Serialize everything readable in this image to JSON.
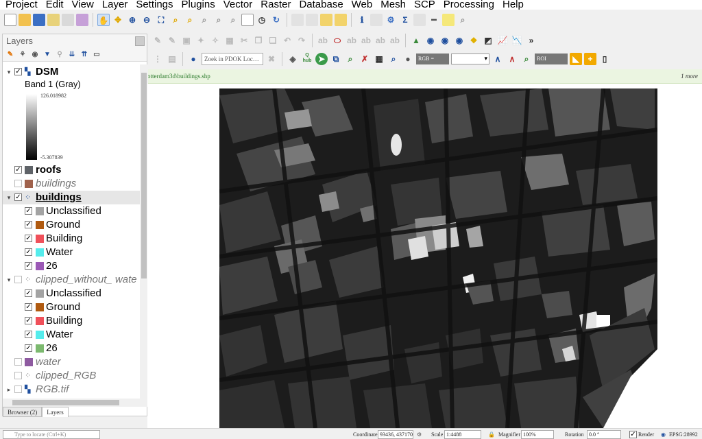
{
  "menu": [
    "Project",
    "Edit",
    "View",
    "Layer",
    "Settings",
    "Plugins",
    "Vector",
    "Raster",
    "Database",
    "Web",
    "Mesh",
    "SCP",
    "Processing",
    "Help"
  ],
  "toolbar3": {
    "pdok_placeholder": "Zoek in PDOK Loc…",
    "hub_label": "hub",
    "rgb_label": "RGB =",
    "roi_label": "ROI"
  },
  "message_bar": {
    "path": "otterdam3d\\buildings.shp",
    "more": "1 more"
  },
  "layers_panel": {
    "title": "Layers",
    "dsm": {
      "name": "DSM",
      "band": "Band 1 (Gray)",
      "max": "126.018982",
      "min": "-5.307839"
    },
    "layers": [
      {
        "name": "roofs",
        "checked": true,
        "color": "#5f6368",
        "style": "bold"
      },
      {
        "name": "buildings",
        "checked": false,
        "color": "#a0624c",
        "style": "italic"
      },
      {
        "name": "buildings",
        "checked": true,
        "style": "underline",
        "selected": true
      }
    ],
    "buildings_classes": [
      {
        "label": "Unclassified",
        "color": "#a3a3a3"
      },
      {
        "label": "Ground",
        "color": "#b05a10"
      },
      {
        "label": "Building",
        "color": "#f0505a"
      },
      {
        "label": "Water",
        "color": "#55ecec"
      },
      {
        "label": "26",
        "color": "#9b59b6"
      }
    ],
    "clipped_without_water": {
      "name": "clipped_without_ wate"
    },
    "clipped_classes": [
      {
        "label": "Unclassified",
        "color": "#a3a3a3"
      },
      {
        "label": "Ground",
        "color": "#b05a10"
      },
      {
        "label": "Building",
        "color": "#f0505a"
      },
      {
        "label": "Water",
        "color": "#55ecec"
      },
      {
        "label": "26",
        "color": "#7cb96f"
      }
    ],
    "bottom_layers": [
      {
        "name": "water",
        "color": "#8e5aa0"
      },
      {
        "name": "clipped_RGB"
      },
      {
        "name": "RGB.tif"
      }
    ],
    "tabs": [
      "Browser (2)",
      "Layers"
    ]
  },
  "statusbar": {
    "locate_placeholder": "Type to locate (Ctrl+K)",
    "coordinate_label": "Coordinate",
    "coordinate_value": "93436, 437170",
    "scale_label": "Scale",
    "scale_value": "1:4488",
    "magnifier_label": "Magnifier",
    "magnifier_value": "100%",
    "rotation_label": "Rotation",
    "rotation_value": "0.0 °",
    "render_label": "Render",
    "epsg": "EPSG:28992"
  },
  "colors": {
    "accent": "#2a7a2a",
    "map_background": "#1e1e1e"
  }
}
